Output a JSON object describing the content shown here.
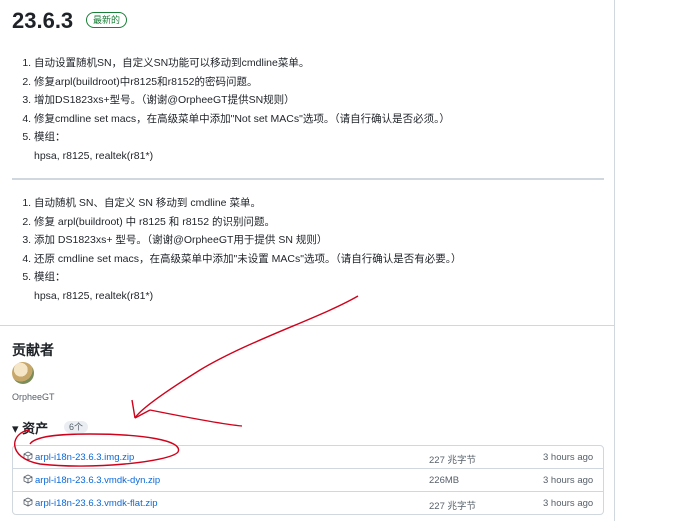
{
  "release": {
    "tag": "23.6.3",
    "badge": "最新的"
  },
  "notes_a": [
    "自动设置随机SN，自定义SN功能可以移动到cmdline菜单。",
    "修复arpl(buildroot)中r8125和r8152的密码问题。",
    "增加DS1823xs+型号。（谢谢@OrpheeGT提供SN规则）",
    "修复cmdline set macs，在高级菜单中添加\"Not set MACs\"选项。（请自行确认是否必须。）",
    "模组："
  ],
  "notes_a_modules": "hpsa, r8125, realtek(r81*)",
  "notes_b": [
    "自动随机 SN、自定义 SN 移动到 cmdline 菜单。",
    "修复 arpl(buildroot) 中 r8125 和 r8152 的识别问题。",
    "添加 DS1823xs+ 型号。（谢谢@OrpheeGT用于提供 SN 规则）",
    "还原 cmdline set macs，在高级菜单中添加\"未设置 MACs\"选项。（请自行确认是否有必要。）",
    "模组："
  ],
  "notes_b_modules": "hpsa, r8125, realtek(r81*)",
  "contributors": {
    "title": "贡献者",
    "name": "OrpheeGT"
  },
  "assets": {
    "title": "资产",
    "count": "6个",
    "items": [
      {
        "name": "arpl-i18n-23.6.3.img.zip",
        "size": "227 兆字节",
        "time": "3 hours ago"
      },
      {
        "name": "arpl-i18n-23.6.3.vmdk-dyn.zip",
        "size": "226MB",
        "time": "3 hours ago"
      },
      {
        "name": "arpl-i18n-23.6.3.vmdk-flat.zip",
        "size": "227 兆字节",
        "time": "3 hours ago"
      }
    ]
  },
  "colors": {
    "link": "#0969da",
    "badge": "#1a7f37",
    "annotation": "#d0021b"
  }
}
